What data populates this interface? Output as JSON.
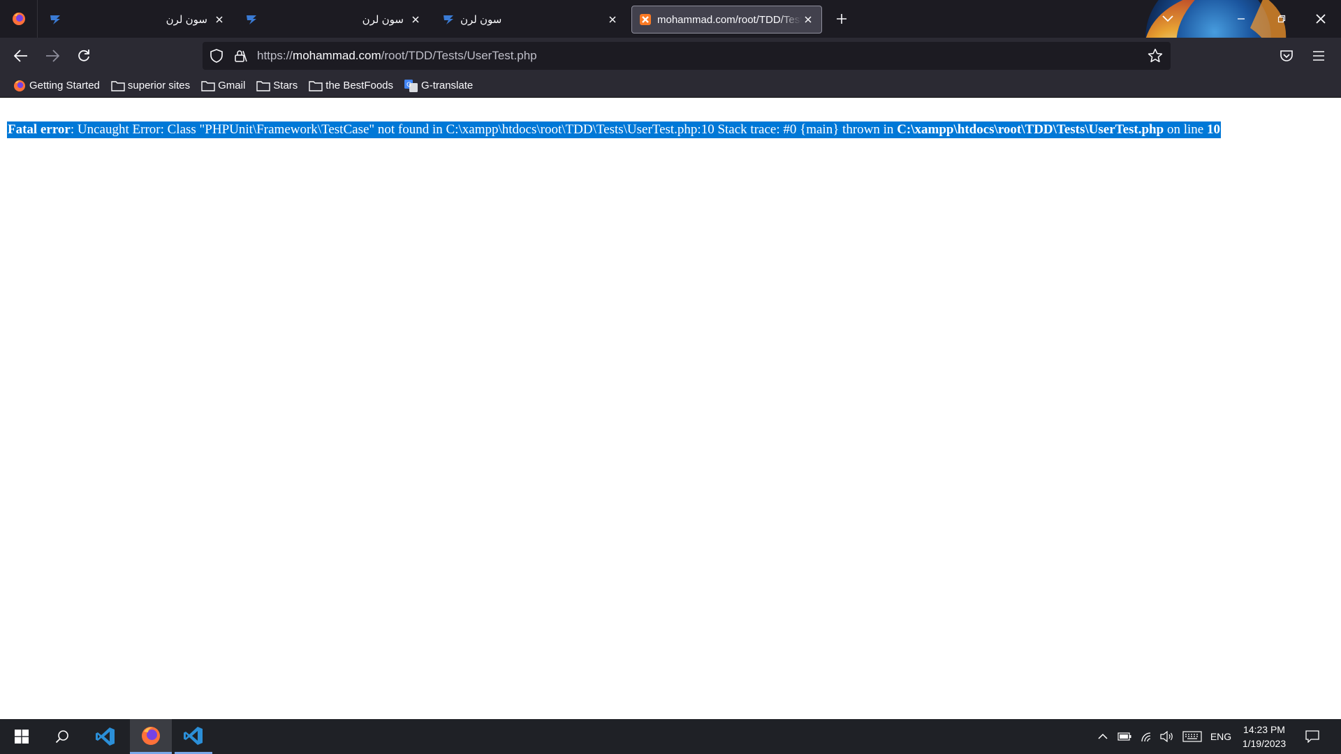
{
  "browser": {
    "tabs": [
      {
        "title": "سون لرن",
        "active": false
      },
      {
        "title": "سون لرن",
        "active": false
      },
      {
        "title": "سون لرن",
        "active": false
      },
      {
        "title": "mohammad.com/root/TDD/Tests/UserTest.php",
        "active": true
      }
    ],
    "url": {
      "prefix": "https://",
      "domain": "mohammad.com",
      "path": "/root/TDD/Tests/UserTest.php"
    },
    "bookmarks": [
      {
        "label": "Getting Started",
        "icon": "firefox-icon"
      },
      {
        "label": "superior sites",
        "icon": "folder-icon"
      },
      {
        "label": "Gmail",
        "icon": "folder-icon"
      },
      {
        "label": "Stars",
        "icon": "folder-icon"
      },
      {
        "label": "the BestFoods",
        "icon": "folder-icon"
      },
      {
        "label": "G-translate",
        "icon": "google-translate-icon"
      }
    ],
    "colors": {
      "titlebar": "#1c1b22",
      "toolbar": "#2b2a33",
      "selection": "#0078d7"
    }
  },
  "page": {
    "error": {
      "label": "Fatal error",
      "message": ": Uncaught Error: Class \"PHPUnit\\Framework\\TestCase\" not found in C:\\xampp\\htdocs\\root\\TDD\\Tests\\UserTest.php:10 Stack trace: #0 {main} thrown in ",
      "file": "C:\\xampp\\htdocs\\root\\TDD\\Tests\\UserTest.php",
      "line_text": " on line ",
      "line": "10"
    }
  },
  "taskbar": {
    "language": "ENG",
    "time": "14:23 PM",
    "date": "1/19/2023"
  }
}
